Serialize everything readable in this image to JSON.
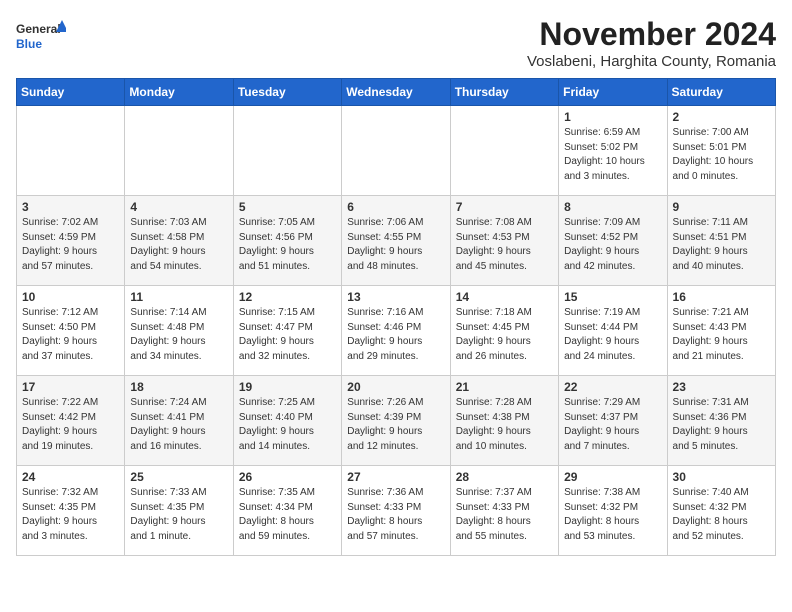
{
  "header": {
    "logo_line1": "General",
    "logo_line2": "Blue",
    "month": "November 2024",
    "location": "Voslabeni, Harghita County, Romania"
  },
  "weekdays": [
    "Sunday",
    "Monday",
    "Tuesday",
    "Wednesday",
    "Thursday",
    "Friday",
    "Saturday"
  ],
  "weeks": [
    [
      {
        "day": "",
        "info": ""
      },
      {
        "day": "",
        "info": ""
      },
      {
        "day": "",
        "info": ""
      },
      {
        "day": "",
        "info": ""
      },
      {
        "day": "",
        "info": ""
      },
      {
        "day": "1",
        "info": "Sunrise: 6:59 AM\nSunset: 5:02 PM\nDaylight: 10 hours\nand 3 minutes."
      },
      {
        "day": "2",
        "info": "Sunrise: 7:00 AM\nSunset: 5:01 PM\nDaylight: 10 hours\nand 0 minutes."
      }
    ],
    [
      {
        "day": "3",
        "info": "Sunrise: 7:02 AM\nSunset: 4:59 PM\nDaylight: 9 hours\nand 57 minutes."
      },
      {
        "day": "4",
        "info": "Sunrise: 7:03 AM\nSunset: 4:58 PM\nDaylight: 9 hours\nand 54 minutes."
      },
      {
        "day": "5",
        "info": "Sunrise: 7:05 AM\nSunset: 4:56 PM\nDaylight: 9 hours\nand 51 minutes."
      },
      {
        "day": "6",
        "info": "Sunrise: 7:06 AM\nSunset: 4:55 PM\nDaylight: 9 hours\nand 48 minutes."
      },
      {
        "day": "7",
        "info": "Sunrise: 7:08 AM\nSunset: 4:53 PM\nDaylight: 9 hours\nand 45 minutes."
      },
      {
        "day": "8",
        "info": "Sunrise: 7:09 AM\nSunset: 4:52 PM\nDaylight: 9 hours\nand 42 minutes."
      },
      {
        "day": "9",
        "info": "Sunrise: 7:11 AM\nSunset: 4:51 PM\nDaylight: 9 hours\nand 40 minutes."
      }
    ],
    [
      {
        "day": "10",
        "info": "Sunrise: 7:12 AM\nSunset: 4:50 PM\nDaylight: 9 hours\nand 37 minutes."
      },
      {
        "day": "11",
        "info": "Sunrise: 7:14 AM\nSunset: 4:48 PM\nDaylight: 9 hours\nand 34 minutes."
      },
      {
        "day": "12",
        "info": "Sunrise: 7:15 AM\nSunset: 4:47 PM\nDaylight: 9 hours\nand 32 minutes."
      },
      {
        "day": "13",
        "info": "Sunrise: 7:16 AM\nSunset: 4:46 PM\nDaylight: 9 hours\nand 29 minutes."
      },
      {
        "day": "14",
        "info": "Sunrise: 7:18 AM\nSunset: 4:45 PM\nDaylight: 9 hours\nand 26 minutes."
      },
      {
        "day": "15",
        "info": "Sunrise: 7:19 AM\nSunset: 4:44 PM\nDaylight: 9 hours\nand 24 minutes."
      },
      {
        "day": "16",
        "info": "Sunrise: 7:21 AM\nSunset: 4:43 PM\nDaylight: 9 hours\nand 21 minutes."
      }
    ],
    [
      {
        "day": "17",
        "info": "Sunrise: 7:22 AM\nSunset: 4:42 PM\nDaylight: 9 hours\nand 19 minutes."
      },
      {
        "day": "18",
        "info": "Sunrise: 7:24 AM\nSunset: 4:41 PM\nDaylight: 9 hours\nand 16 minutes."
      },
      {
        "day": "19",
        "info": "Sunrise: 7:25 AM\nSunset: 4:40 PM\nDaylight: 9 hours\nand 14 minutes."
      },
      {
        "day": "20",
        "info": "Sunrise: 7:26 AM\nSunset: 4:39 PM\nDaylight: 9 hours\nand 12 minutes."
      },
      {
        "day": "21",
        "info": "Sunrise: 7:28 AM\nSunset: 4:38 PM\nDaylight: 9 hours\nand 10 minutes."
      },
      {
        "day": "22",
        "info": "Sunrise: 7:29 AM\nSunset: 4:37 PM\nDaylight: 9 hours\nand 7 minutes."
      },
      {
        "day": "23",
        "info": "Sunrise: 7:31 AM\nSunset: 4:36 PM\nDaylight: 9 hours\nand 5 minutes."
      }
    ],
    [
      {
        "day": "24",
        "info": "Sunrise: 7:32 AM\nSunset: 4:35 PM\nDaylight: 9 hours\nand 3 minutes."
      },
      {
        "day": "25",
        "info": "Sunrise: 7:33 AM\nSunset: 4:35 PM\nDaylight: 9 hours\nand 1 minute."
      },
      {
        "day": "26",
        "info": "Sunrise: 7:35 AM\nSunset: 4:34 PM\nDaylight: 8 hours\nand 59 minutes."
      },
      {
        "day": "27",
        "info": "Sunrise: 7:36 AM\nSunset: 4:33 PM\nDaylight: 8 hours\nand 57 minutes."
      },
      {
        "day": "28",
        "info": "Sunrise: 7:37 AM\nSunset: 4:33 PM\nDaylight: 8 hours\nand 55 minutes."
      },
      {
        "day": "29",
        "info": "Sunrise: 7:38 AM\nSunset: 4:32 PM\nDaylight: 8 hours\nand 53 minutes."
      },
      {
        "day": "30",
        "info": "Sunrise: 7:40 AM\nSunset: 4:32 PM\nDaylight: 8 hours\nand 52 minutes."
      }
    ]
  ]
}
